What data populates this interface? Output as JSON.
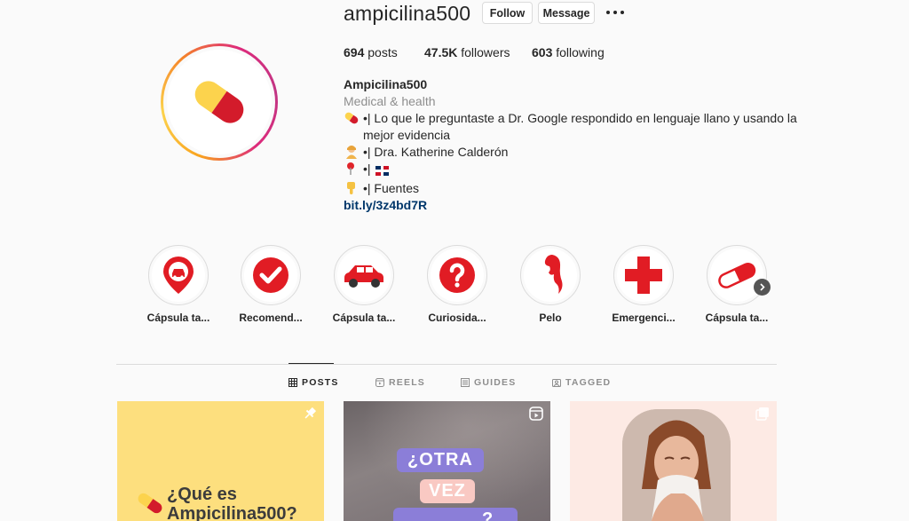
{
  "profile": {
    "username": "ampicilina500",
    "follow_label": "Follow",
    "message_label": "Message",
    "stats": {
      "posts_count": "694",
      "posts_label": "posts",
      "followers_count": "47.5K",
      "followers_label": "followers",
      "following_count": "603",
      "following_label": "following"
    },
    "bio": {
      "name": "Ampicilina500",
      "category": "Medical & health",
      "line1": "•| Lo que le preguntaste a Dr. Google respondido en lenguaje llano y usando la mejor evidencia",
      "line2": "•| Dra. Katherine Calderón",
      "line3": "•|",
      "line4": "•| Fuentes",
      "link": "bit.ly/3z4bd7R",
      "icons": [
        "pill-icon",
        "doctor-icon",
        "pin-icon",
        "dominican-flag-icon",
        "pointing-down-icon"
      ]
    }
  },
  "highlights": [
    {
      "label": "Cápsula ta...",
      "icon": "car-location-icon"
    },
    {
      "label": "Recomend...",
      "icon": "check-icon"
    },
    {
      "label": "Cápsula ta...",
      "icon": "car-icon"
    },
    {
      "label": "Curiosida...",
      "icon": "question-icon"
    },
    {
      "label": "Pelo",
      "icon": "hair-icon"
    },
    {
      "label": "Emergenci...",
      "icon": "red-cross-icon"
    },
    {
      "label": "Cápsula ta...",
      "icon": "capsule-icon"
    }
  ],
  "tabs": [
    {
      "label": "POSTS",
      "active": true
    },
    {
      "label": "REELS",
      "active": false
    },
    {
      "label": "GUIDES",
      "active": false
    },
    {
      "label": "TAGGED",
      "active": false
    }
  ],
  "posts": [
    {
      "title": "¿Qué es Ampicilina500?",
      "icon": "pin-icon"
    },
    {
      "title_line1": "¿OTRA",
      "title_line2": "VEZ",
      "title_line3": "?",
      "icon": "reels-icon"
    },
    {
      "icon": "multiple-images-icon"
    }
  ],
  "colors": {
    "text": "#262626",
    "muted": "#8e8e8e",
    "link": "#00376b",
    "brand_red": "#e11c24",
    "brand_yellow": "#fcd34d",
    "post1_bg": "#fddf7e",
    "post3_bg": "#fdeae4",
    "purple_label": "#8b7ed8"
  }
}
